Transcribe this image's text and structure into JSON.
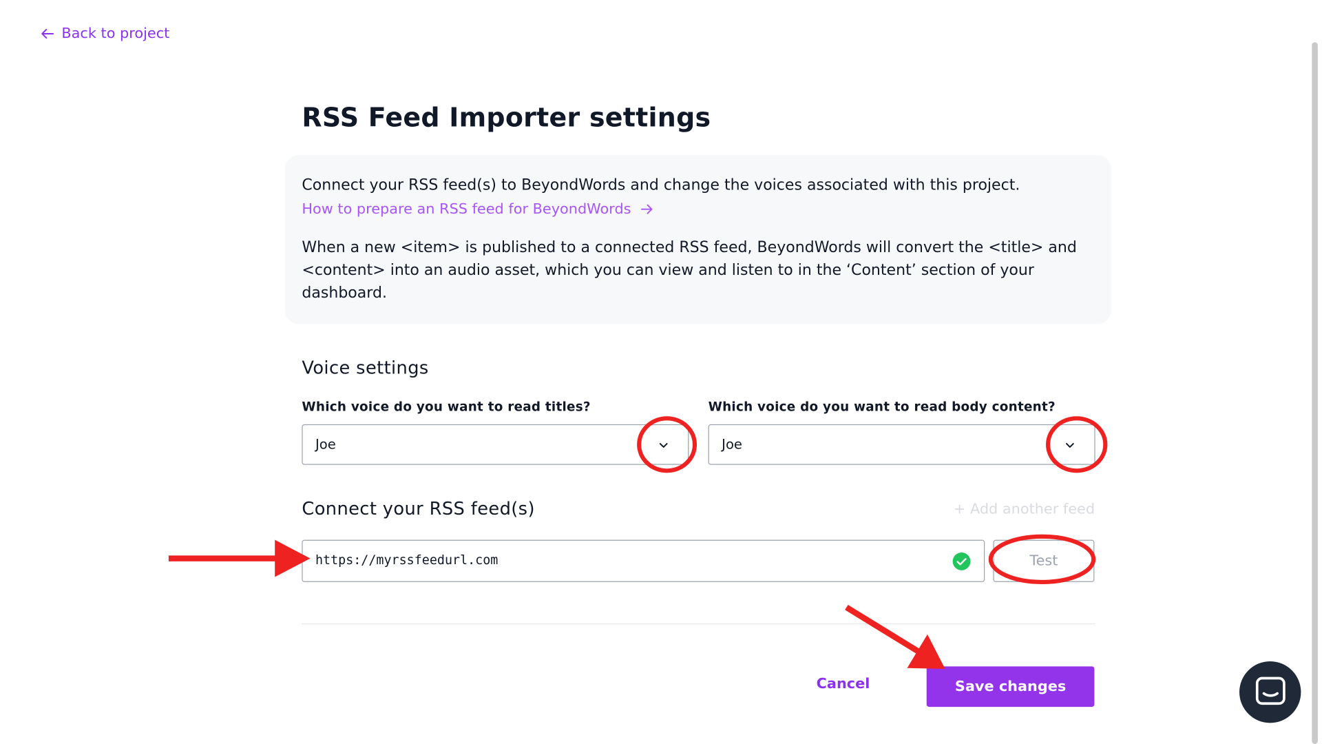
{
  "nav": {
    "back_label": "Back to project"
  },
  "page": {
    "title": "RSS Feed Importer settings"
  },
  "info": {
    "intro": "Connect your RSS feed(s) to BeyondWords and change the voices associated with this project.",
    "link_label": "How to prepare an RSS feed for BeyondWords",
    "body": "When a new <item> is published to a connected RSS feed, BeyondWords will convert the <title> and <content> into an audio asset, which you can view and listen to in the ‘Content’ section of your dashboard."
  },
  "voice_settings": {
    "heading": "Voice settings",
    "title_voice": {
      "label": "Which voice do you want to read titles?",
      "value": "Joe"
    },
    "body_voice": {
      "label": "Which voice do you want to read body content?",
      "value": "Joe"
    }
  },
  "rss": {
    "heading": "Connect your RSS feed(s)",
    "add_feed_label": "+ Add another feed",
    "feed_url": "https://myrssfeedurl.com",
    "feed_valid": true,
    "test_label": "Test"
  },
  "actions": {
    "cancel_label": "Cancel",
    "save_label": "Save changes"
  },
  "colors": {
    "accent": "#9333ea",
    "link": "#a855f7",
    "success": "#22c55e",
    "annotation": "#ef2222"
  },
  "icons": {
    "back": "arrow-left-icon",
    "link": "arrow-right-icon",
    "dropdown": "chevron-down-icon",
    "valid": "check-circle-icon",
    "chat": "chat-bubble-icon"
  }
}
